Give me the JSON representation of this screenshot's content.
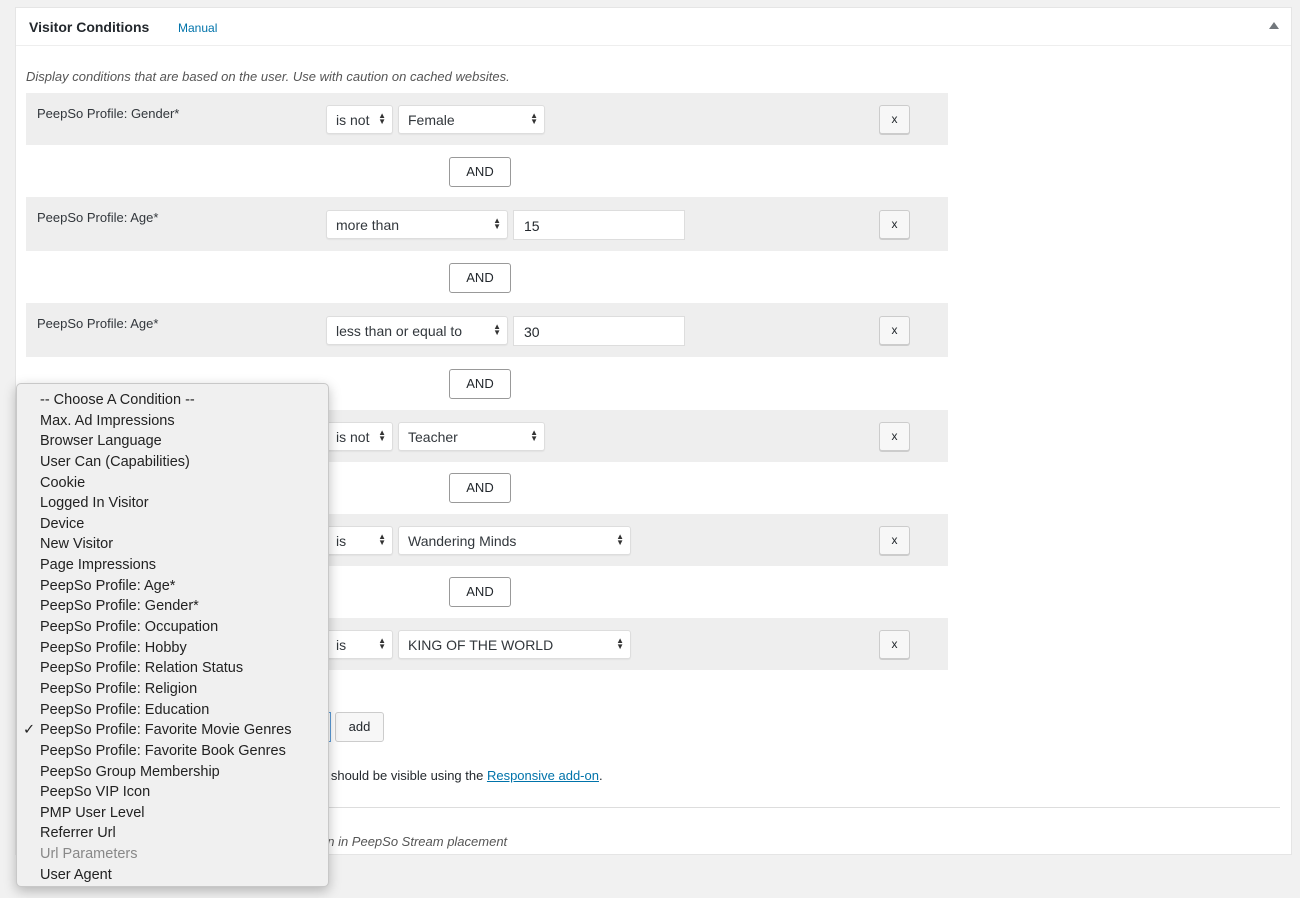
{
  "panel": {
    "title": "Visitor Conditions",
    "manual_link": "Manual",
    "description": "Display conditions that are based on the user. Use with caution on cached websites."
  },
  "conditions": [
    {
      "label": "PeepSo Profile: Gender*",
      "operator": "is not",
      "value": "Female",
      "type": "select"
    },
    {
      "label": "PeepSo Profile: Age*",
      "operator": "more than",
      "value": "15",
      "type": "input"
    },
    {
      "label": "PeepSo Profile: Age*",
      "operator": "less than or equal to",
      "value": "30",
      "type": "input"
    },
    {
      "label": "",
      "operator": "is not",
      "value": "Teacher",
      "type": "select"
    },
    {
      "label": "",
      "operator": "is",
      "value": "Wandering Minds",
      "type": "select"
    },
    {
      "label": "",
      "operator": "is",
      "value": "KING OF THE WORLD",
      "type": "select"
    }
  ],
  "connector_label": "AND",
  "remove_label": "x",
  "add_label": "add",
  "note": {
    "prefix": "d should be visible using the ",
    "link": "Responsive add-on",
    "suffix": "."
  },
  "note2": "en in PeepSo Stream placement",
  "dropdown": {
    "selected": "PeepSo Profile: Favorite Movie Genres",
    "disabled": [
      "Url Parameters"
    ],
    "options": [
      "-- Choose A Condition --",
      "Max. Ad Impressions",
      "Browser Language",
      "User Can (Capabilities)",
      "Cookie",
      "Logged In Visitor",
      "Device",
      "New Visitor",
      "Page Impressions",
      "PeepSo Profile: Age*",
      "PeepSo Profile: Gender*",
      "PeepSo Profile: Occupation",
      "PeepSo Profile: Hobby",
      "PeepSo Profile: Relation Status",
      "PeepSo Profile: Religion",
      "PeepSo Profile: Education",
      "PeepSo Profile: Favorite Movie Genres",
      "PeepSo Profile: Favorite Book Genres",
      "PeepSo Group Membership",
      "PeepSo VIP Icon",
      "PMP User Level",
      "Referrer Url",
      "Url Parameters",
      "User Agent"
    ]
  },
  "colors": {
    "link": "#0073aa",
    "row_bg": "#eeeeee"
  }
}
